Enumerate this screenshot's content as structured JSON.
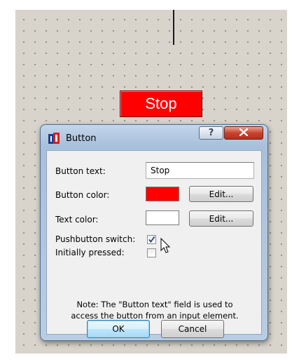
{
  "canvas": {
    "stop_widget": {
      "label": "Stop",
      "bg_color": "#ff0000",
      "text_color": "#ffffff"
    }
  },
  "dialog": {
    "title": "Button",
    "app_icon": "app-icon",
    "title_buttons": {
      "help_label": "?",
      "close_icon": "close-icon"
    },
    "fields": {
      "button_text_label": "Button text:",
      "button_text_value": "Stop",
      "button_color_label": "Button color:",
      "button_color_value": "#ff0000",
      "button_color_edit": "Edit...",
      "text_color_label": "Text color:",
      "text_color_value": "#ffffff",
      "text_color_edit": "Edit...",
      "pushbutton_label": "Pushbutton switch:",
      "pushbutton_checked": true,
      "initially_pressed_label": "Initially pressed:",
      "initially_pressed_checked": false
    },
    "note_line1": "Note: The \"Button text\" field is used to",
    "note_line2": "access the button from an input element.",
    "ok_label": "OK",
    "cancel_label": "Cancel"
  }
}
